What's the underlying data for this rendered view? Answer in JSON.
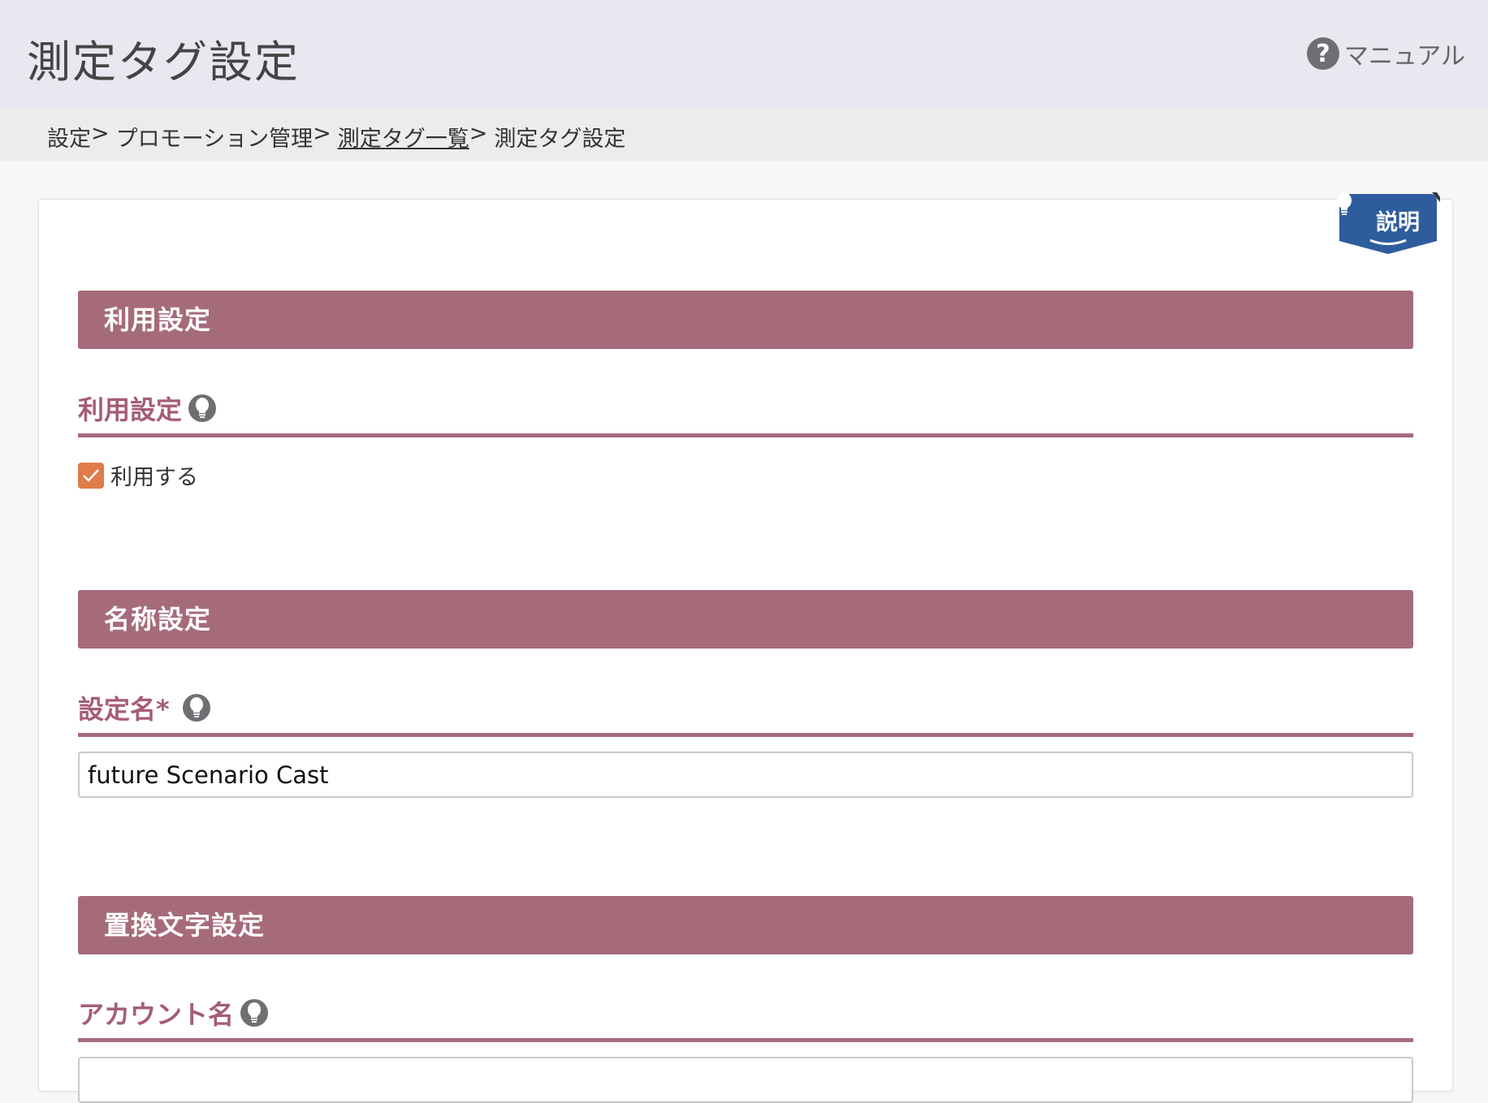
{
  "header": {
    "title": "測定タグ設定",
    "manual_label": "マニュアル"
  },
  "breadcrumb": {
    "items": [
      "設定",
      "プロモーション管理",
      "測定タグ一覧",
      "測定タグ設定"
    ],
    "separator": ">"
  },
  "explain_tab": {
    "label": "説明"
  },
  "sections": {
    "usage": {
      "title": "利用設定",
      "field_label": "利用設定",
      "checkbox_label": "利用する",
      "checkbox_checked": true
    },
    "name": {
      "title": "名称設定",
      "field_label": "設定名*",
      "input_value": "future Scenario Cast"
    },
    "replace": {
      "title": "置換文字設定",
      "field_label": "アカウント名"
    }
  },
  "colors": {
    "section_bar": "#a66b7a",
    "label_text": "#a45d74",
    "checkbox": "#e07b4a",
    "explain_tab": "#2e5d9e",
    "header_bg": "#e9e7f0"
  }
}
